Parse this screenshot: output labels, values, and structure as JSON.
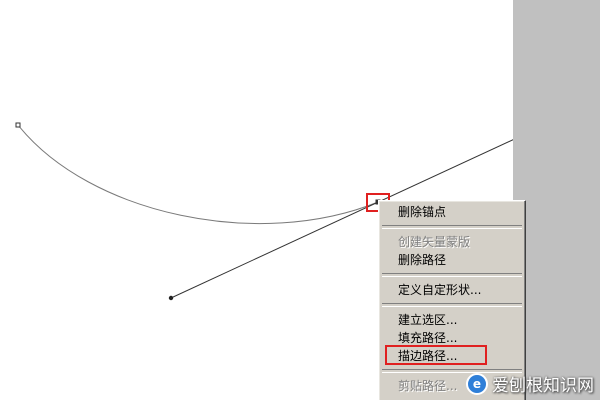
{
  "menu": {
    "items": [
      {
        "label": "删除锚点",
        "enabled": true
      },
      {
        "label": "创建矢量蒙版",
        "enabled": false
      },
      {
        "label": "删除路径",
        "enabled": true
      },
      {
        "label": "定义自定形状...",
        "enabled": true
      },
      {
        "label": "建立选区...",
        "enabled": true
      },
      {
        "label": "填充路径...",
        "enabled": true
      },
      {
        "label": "描边路径...",
        "enabled": true,
        "highlighted": true
      },
      {
        "label": "剪贴路径...",
        "enabled": false
      }
    ]
  },
  "watermark": {
    "text": "爱刨根知识网",
    "logo_glyph": "e"
  },
  "colors": {
    "highlight_box": "#e02020",
    "menu_background": "#d4d0c8",
    "panel_gray": "#c0c0c0",
    "path_line": "#333333"
  },
  "icons": [
    "anchor-point-icon",
    "direction-handle-icon"
  ]
}
